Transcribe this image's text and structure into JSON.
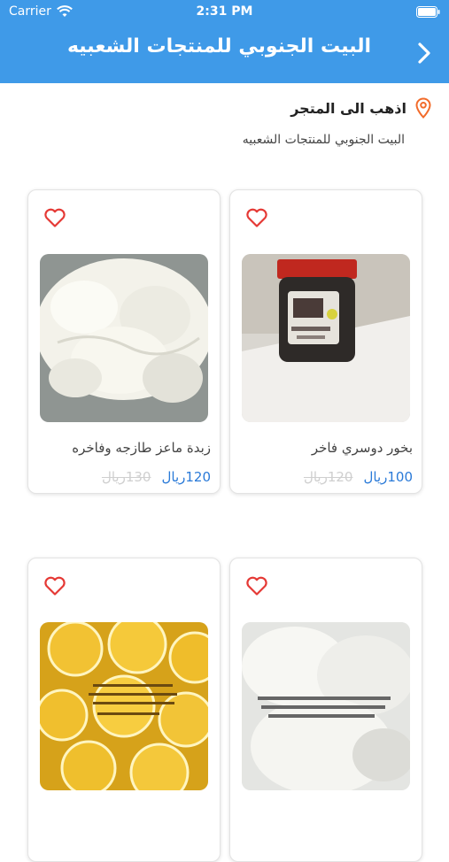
{
  "status_bar": {
    "carrier": "Carrier",
    "time": "2:31 PM"
  },
  "header": {
    "title": "البيت الجنوبي للمنتجات الشعبيه",
    "back_icon": "chevron-right-icon"
  },
  "store": {
    "link_label": "اذهب الى المتجر",
    "name": "البيت الجنوبي للمنتجات الشعبيه",
    "pin_icon": "location-pin-icon"
  },
  "colors": {
    "header_bg": "#3f9ae8",
    "price": "#2a7ad8",
    "heart": "#e53935",
    "pin": "#f26b2a"
  },
  "products": [
    {
      "name": "بخور دوسري فاخر",
      "price": "100ريال",
      "old_price": "120ريال",
      "image": "incense-jar"
    },
    {
      "name": "زبدة ماعز طازجه وفاخره",
      "price": "120ريال",
      "old_price": "130ريال",
      "image": "goat-butter"
    },
    {
      "name": "",
      "price": "",
      "old_price": "",
      "image": "white-butter"
    },
    {
      "name": "",
      "price": "",
      "old_price": "",
      "image": "ghee-glasses"
    }
  ]
}
